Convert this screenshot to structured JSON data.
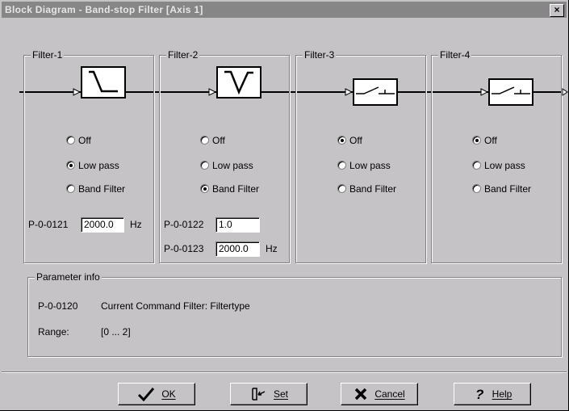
{
  "window": {
    "title": "Block Diagram - Band-stop Filter [Axis 1]",
    "close_label": "×"
  },
  "filters": [
    {
      "label": "Filter-1",
      "options": [
        "Off",
        "Low pass",
        "Band Filter"
      ],
      "selected": "Low pass",
      "icon": "low-pass-response-icon",
      "params": [
        {
          "id": "P-0-0121",
          "value": "2000.0",
          "unit": "Hz"
        }
      ]
    },
    {
      "label": "Filter-2",
      "options": [
        "Off",
        "Low pass",
        "Band Filter"
      ],
      "selected": "Band Filter",
      "icon": "band-stop-response-icon",
      "params": [
        {
          "id": "P-0-0122",
          "value": "1.0",
          "unit": ""
        },
        {
          "id": "P-0-0123",
          "value": "2000.0",
          "unit": "Hz"
        }
      ]
    },
    {
      "label": "Filter-3",
      "options": [
        "Off",
        "Low pass",
        "Band Filter"
      ],
      "selected": "Off",
      "icon": "bypass-switch-icon",
      "params": []
    },
    {
      "label": "Filter-4",
      "options": [
        "Off",
        "Low pass",
        "Band Filter"
      ],
      "selected": "Off",
      "icon": "bypass-switch-icon",
      "params": []
    }
  ],
  "parameter_info": {
    "label": "Parameter info",
    "param_id": "P-0-0120",
    "description": "Current Command Filter: Filtertype",
    "range_label": "Range:",
    "range_value": "[0 ... 2]"
  },
  "buttons": {
    "ok": "OK",
    "set": "Set",
    "cancel": "Cancel",
    "help": "Help"
  },
  "colors": {
    "face": "#c6c3c6",
    "titlebar": "#868686",
    "title_text": "#e6e6e6",
    "shadow": "#808080",
    "highlight": "#ffffff"
  }
}
